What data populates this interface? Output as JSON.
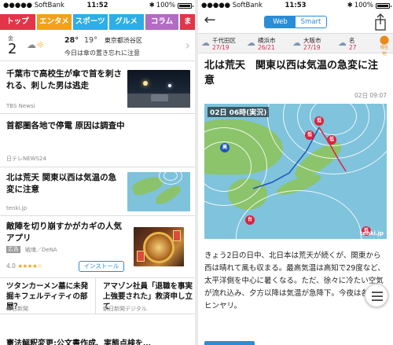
{
  "left": {
    "status": {
      "carrier": "●●●●● SoftBank",
      "time": "11:52",
      "battery": "100%"
    },
    "tabs": [
      "トップ",
      "エンタメ",
      "スポーツ",
      "グルメ",
      "コラム",
      "ま"
    ],
    "weather": {
      "month": "金",
      "day": "2",
      "high": "28°",
      "low": "19°",
      "location": "東京都渋谷区",
      "note": "今日は傘の置き忘れに注意"
    },
    "news": [
      {
        "title": "千葉市で高校生が傘で首を刺される、刺した男は逃走",
        "source": "TBS Newsi"
      },
      {
        "title": "首都圏各地で停電 原因は調査中",
        "source": "日テレNEWS24"
      },
      {
        "title": "北は荒天 関東以西は気温の急変に注意",
        "source": "tenki.jp"
      }
    ],
    "ad": {
      "title": "敵陣を切り崩すかがカギの人気アプリ",
      "badge": "広告",
      "maker": "戦魂／DeNA",
      "rating": "4.0",
      "stars": "★★★★☆",
      "install_label": "インストール"
    },
    "split": [
      {
        "title": "ツタンカーメン墓に未発掘キフェルティティの部屋？",
        "source": "毎日新聞"
      },
      {
        "title": "アマゾン社員「退職を事実上強要された」救済申し立て",
        "source": "朝日新聞デジタル"
      }
    ],
    "cut_headline": "憲法解釈変更:公文書作成、実態点検を…"
  },
  "right": {
    "status": {
      "carrier": "●●●●● SoftBank",
      "time": "11:53",
      "battery": "100%"
    },
    "segment": {
      "web": "Web",
      "smart": "Smart"
    },
    "cities": [
      {
        "name": "千代田区",
        "temps": "27/19"
      },
      {
        "name": "横浜市",
        "temps": "26/21"
      },
      {
        "name": "大阪市",
        "temps": "27/19"
      },
      {
        "name": "名",
        "temps": "27"
      }
    ],
    "current_location_label": "現在地",
    "article": {
      "title": "北は荒天　関東以西は気温の急変に注意",
      "date": "02日 09:07",
      "map_label": "02日 06時(実況)",
      "map_brand": "tenki.jp",
      "map_markers": {
        "low": "低",
        "high": "高",
        "typhoon": "台"
      },
      "body": "きょう2日の日中、北日本は荒天が続くが、関東から西は晴れて風も収まる。最高気温は高知で29度など、太平洋側を中心に暑くなる。ただ、徐々に冷たい空気が流れ込み、夕方以降は気温が急降下。今夜は各地でヒンヤリ。"
    }
  },
  "colors": {
    "tab_top": "#e5334a",
    "tab_ent": "#f0a21a",
    "tab_blue": "#2eaee4",
    "tab_column": "#b26cc3",
    "accent_blue": "#2b8cd7",
    "temp_red": "#d6294c",
    "star": "#f3a21e"
  }
}
